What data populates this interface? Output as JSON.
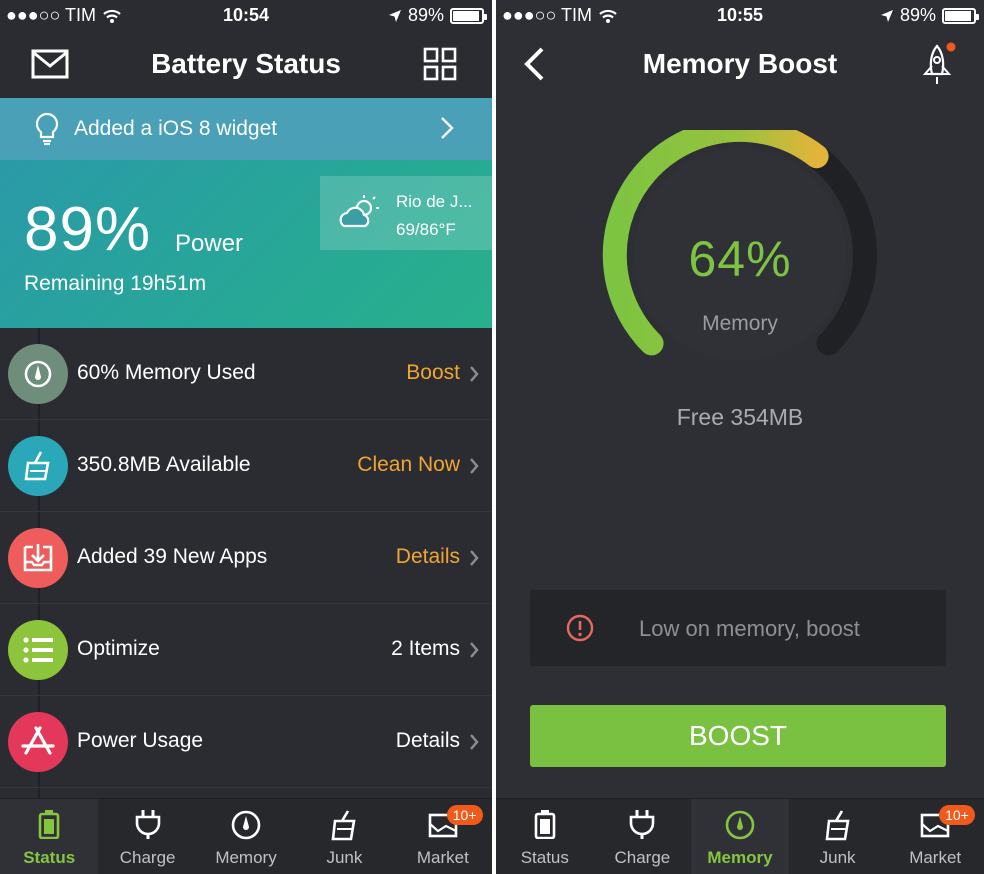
{
  "colors": {
    "background_dark": "#2a2c31",
    "teal_banner": "#4aa0b7",
    "teal_panel": "#27a896",
    "accent_orange": "#f0a533",
    "accent_green": "#7ac142",
    "badge_red": "#f25a1c"
  },
  "left_screen": {
    "status_bar": {
      "carrier": "●●●○○ TIM",
      "time": "10:54",
      "battery": "89%"
    },
    "nav": {
      "title": "Battery Status",
      "left_icon": "mail-icon",
      "right_icon": "grid-icon"
    },
    "widget_banner": {
      "icon": "lightbulb-icon",
      "text": "Added a iOS 8 widget"
    },
    "power": {
      "percent": "89%",
      "percent_label": "Power",
      "remaining_prefix": "Remaining",
      "hours": "19",
      "hours_unit": "h",
      "minutes": "51",
      "minutes_unit": "m"
    },
    "weather": {
      "icon": "partly-cloudy-icon",
      "city": "Rio de J...",
      "temperature": "69/86°F"
    },
    "items": [
      {
        "label": "60% Memory Used",
        "action": "Boost",
        "action_color": "#f0a533",
        "icon": "gauge-icon",
        "circle_color": "#6e8e7b"
      },
      {
        "label": "350.8MB Available",
        "action": "Clean Now",
        "action_color": "#f0a533",
        "icon": "broom-icon",
        "circle_color": "#2aa7b9"
      },
      {
        "label": "Added 39 New Apps",
        "action": "Details",
        "action_color": "#f0a533",
        "icon": "download-tray-icon",
        "circle_color": "#ee5c5c"
      },
      {
        "label": "Optimize",
        "action": "2 Items",
        "action_color": "#ffffff",
        "icon": "list-icon",
        "circle_color": "#8cc43c"
      },
      {
        "label": "Power Usage",
        "action": "Details",
        "action_color": "#ffffff",
        "icon": "app-store-icon",
        "circle_color": "#e3385a"
      }
    ],
    "tabs": [
      {
        "label": "Status",
        "icon": "battery-tab-icon",
        "active": true
      },
      {
        "label": "Charge",
        "icon": "plug-icon",
        "active": false
      },
      {
        "label": "Memory",
        "icon": "gauge-tab-icon",
        "active": false
      },
      {
        "label": "Junk",
        "icon": "broom-tab-icon",
        "active": false
      },
      {
        "label": "Market",
        "icon": "market-icon",
        "active": false,
        "badge": "10+"
      }
    ]
  },
  "right_screen": {
    "status_bar": {
      "carrier": "●●●○○ TIM",
      "time": "10:55",
      "battery": "89%"
    },
    "nav": {
      "title": "Memory Boost",
      "left_icon": "back-chevron-icon",
      "right_icon": "rocket-icon"
    },
    "gauge": {
      "value": 0.64,
      "percent": "64%",
      "label": "Memory"
    },
    "free_text": "Free 354MB",
    "warning": {
      "icon": "alert-circle-icon",
      "text": "Low on memory, boost"
    },
    "boost_button": "BOOST",
    "tabs": [
      {
        "label": "Status",
        "icon": "battery-tab-icon",
        "active": false
      },
      {
        "label": "Charge",
        "icon": "plug-icon",
        "active": false
      },
      {
        "label": "Memory",
        "icon": "gauge-tab-icon",
        "active": true
      },
      {
        "label": "Junk",
        "icon": "broom-tab-icon",
        "active": false
      },
      {
        "label": "Market",
        "icon": "market-icon",
        "active": false,
        "badge": "10+"
      }
    ]
  }
}
